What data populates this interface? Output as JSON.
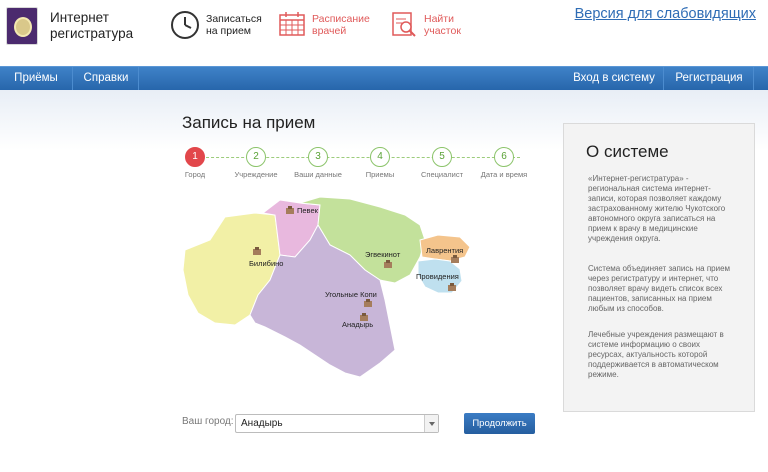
{
  "header": {
    "brand_line1": "Интернет",
    "brand_line2": "регистратура",
    "nav": [
      {
        "label_line1": "Записаться",
        "label_line2": "на прием",
        "icon": "clock-icon"
      },
      {
        "label_line1": "Расписание",
        "label_line2": "врачей",
        "icon": "calendar-icon"
      },
      {
        "label_line1": "Найти",
        "label_line2": "участок",
        "icon": "search-document-icon"
      }
    ],
    "accessibility_link": "Версия для слабовидящих"
  },
  "navbar": {
    "items": [
      "Приёмы",
      "Справки"
    ],
    "login": "Вход в систему",
    "register": "Регистрация"
  },
  "main": {
    "title": "Запись на прием",
    "steps": [
      {
        "num": "1",
        "label": "Город"
      },
      {
        "num": "2",
        "label": "Учреждение"
      },
      {
        "num": "3",
        "label": "Ваши данные"
      },
      {
        "num": "4",
        "label": "Приемы"
      },
      {
        "num": "5",
        "label": "Специалист"
      },
      {
        "num": "6",
        "label": "Дата и время"
      }
    ],
    "active_step": 1,
    "map_labels": [
      "Певек",
      "Билибино",
      "Эгвекинот",
      "Лаврентия",
      "Провидения",
      "Угольные Копи",
      "Анадырь"
    ],
    "city_label": "Ваш город:",
    "city_value": "Анадырь",
    "continue_button": "Продолжить"
  },
  "about": {
    "title": "О системе",
    "p1": "«Интернет-регистратура» - региональная система интернет-записи, которая позволяет каждому застрахованному жителю Чукотского автономного округа записаться на прием к врачу в медицинские учреждения округа.",
    "p2": "Система объединяет запись на прием через регистратуру и интернет, что позволяет врачу видеть список всех пациентов, записанных на прием любым из способов.",
    "p3": "Лечебные учреждения размещают в системе информацию о своих ресурсах, актуальность которой поддерживается в автоматическом режиме."
  },
  "colors": {
    "accent_blue": "#2e6cb5",
    "active_step": "#e2474b",
    "step_green": "#8cc46b",
    "header_red": "#e05a5a"
  }
}
